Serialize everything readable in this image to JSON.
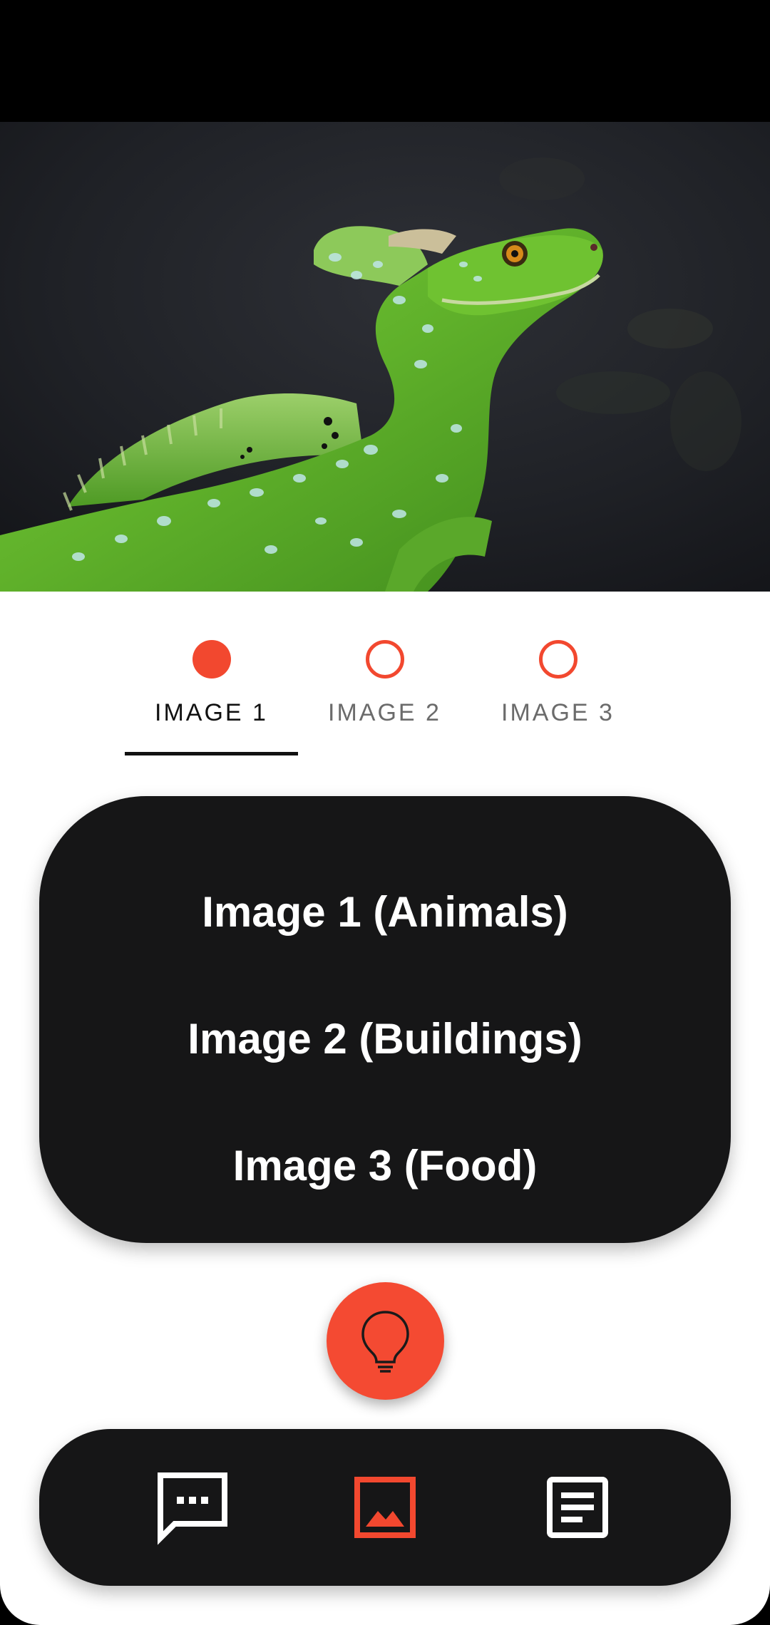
{
  "tabs": [
    {
      "label": "IMAGE 1",
      "selected": true
    },
    {
      "label": "IMAGE 2",
      "selected": false
    },
    {
      "label": "IMAGE 3",
      "selected": false
    }
  ],
  "categories": {
    "option1": "Image 1 (Animals)",
    "option2": "Image 2 (Buildings)",
    "option3": "Image 3 (Food)"
  },
  "fab": {
    "icon": "lightbulb-icon"
  },
  "bottom_nav": {
    "items": [
      {
        "icon": "chat-icon",
        "active": false
      },
      {
        "icon": "image-icon",
        "active": true
      },
      {
        "icon": "document-icon",
        "active": false
      }
    ]
  },
  "colors": {
    "accent": "#f2482f",
    "dark_surface": "#161617",
    "background": "#ffffff"
  }
}
